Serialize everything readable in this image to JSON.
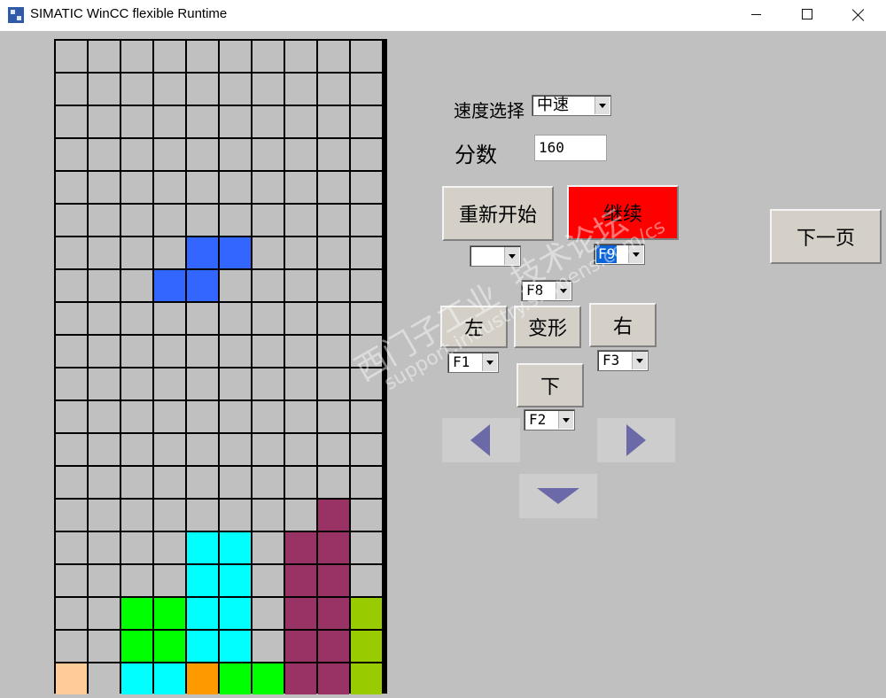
{
  "window": {
    "title": "SIMATIC WinCC flexible Runtime",
    "icon": "wincc-app-icon",
    "controls": [
      "minimize-icon",
      "maximize-icon",
      "close-icon"
    ]
  },
  "board": {
    "columns": 10,
    "rows": 20,
    "empty_color": "#c0c0c0",
    "grid_color": "#000000",
    "filled_cells": [
      {
        "row": 6,
        "col": 4,
        "color": "#3366ff"
      },
      {
        "row": 6,
        "col": 5,
        "color": "#3366ff"
      },
      {
        "row": 7,
        "col": 3,
        "color": "#3366ff"
      },
      {
        "row": 7,
        "col": 4,
        "color": "#3366ff"
      },
      {
        "row": 14,
        "col": 8,
        "color": "#993366"
      },
      {
        "row": 15,
        "col": 4,
        "color": "#00ffff"
      },
      {
        "row": 15,
        "col": 5,
        "color": "#00ffff"
      },
      {
        "row": 15,
        "col": 7,
        "color": "#993366"
      },
      {
        "row": 15,
        "col": 8,
        "color": "#993366"
      },
      {
        "row": 16,
        "col": 4,
        "color": "#00ffff"
      },
      {
        "row": 16,
        "col": 5,
        "color": "#00ffff"
      },
      {
        "row": 16,
        "col": 7,
        "color": "#993366"
      },
      {
        "row": 16,
        "col": 8,
        "color": "#993366"
      },
      {
        "row": 17,
        "col": 2,
        "color": "#00ff00"
      },
      {
        "row": 17,
        "col": 3,
        "color": "#00ff00"
      },
      {
        "row": 17,
        "col": 4,
        "color": "#00ffff"
      },
      {
        "row": 17,
        "col": 5,
        "color": "#00ffff"
      },
      {
        "row": 17,
        "col": 7,
        "color": "#993366"
      },
      {
        "row": 17,
        "col": 8,
        "color": "#993366"
      },
      {
        "row": 17,
        "col": 9,
        "color": "#99cc00"
      },
      {
        "row": 18,
        "col": 2,
        "color": "#00ff00"
      },
      {
        "row": 18,
        "col": 3,
        "color": "#00ff00"
      },
      {
        "row": 18,
        "col": 4,
        "color": "#00ffff"
      },
      {
        "row": 18,
        "col": 5,
        "color": "#00ffff"
      },
      {
        "row": 18,
        "col": 7,
        "color": "#993366"
      },
      {
        "row": 18,
        "col": 8,
        "color": "#993366"
      },
      {
        "row": 18,
        "col": 9,
        "color": "#99cc00"
      },
      {
        "row": 19,
        "col": 0,
        "color": "#ffcc99"
      },
      {
        "row": 19,
        "col": 2,
        "color": "#00ffff"
      },
      {
        "row": 19,
        "col": 3,
        "color": "#00ffff"
      },
      {
        "row": 19,
        "col": 4,
        "color": "#ff9900"
      },
      {
        "row": 19,
        "col": 5,
        "color": "#00ff00"
      },
      {
        "row": 19,
        "col": 6,
        "color": "#00ff00"
      },
      {
        "row": 19,
        "col": 7,
        "color": "#993366"
      },
      {
        "row": 19,
        "col": 8,
        "color": "#993366"
      },
      {
        "row": 19,
        "col": 9,
        "color": "#99cc00"
      }
    ]
  },
  "controls": {
    "speed_label": "速度选择",
    "speed_value": "中速",
    "score_label": "分数",
    "score_value": "160",
    "restart_label": "重新开始",
    "restart_key": "",
    "continue_label": "继续",
    "continue_key": "F9",
    "continue_color": "#ff0000",
    "rotate_key": "F8",
    "left_label": "左",
    "left_key": "F1",
    "rotate_label": "变形",
    "right_label": "右",
    "right_key": "F3",
    "down_label": "下",
    "down_key": "F2",
    "next_page_label": "下一页",
    "arrow_color": "#6b69a8",
    "arrow_icons": [
      "left-arrow-icon",
      "right-arrow-icon",
      "down-arrow-icon"
    ]
  },
  "watermark": {
    "line1": "西门子工业",
    "line2": "support.industry.siemens.com/cs",
    "line3": "技术论坛"
  }
}
